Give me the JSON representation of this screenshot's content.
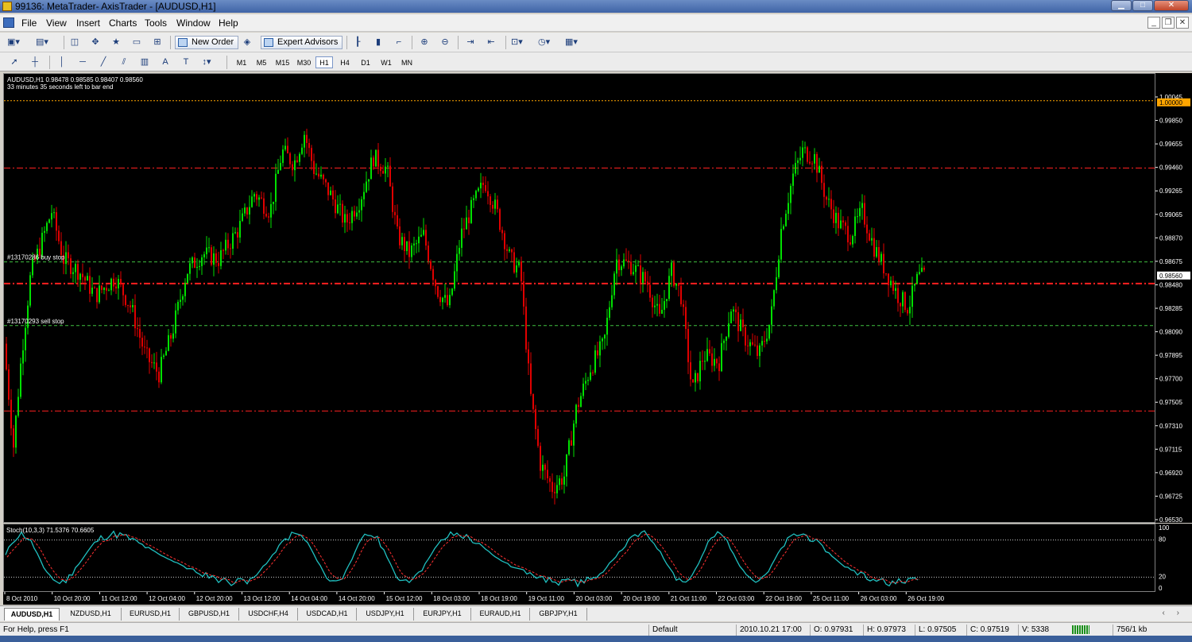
{
  "window": {
    "title": "99136: MetaTrader- AxisTrader - [AUDUSD,H1]"
  },
  "menu": [
    "File",
    "View",
    "Insert",
    "Charts",
    "Tools",
    "Window",
    "Help"
  ],
  "toolbar": {
    "new_order": "New Order",
    "expert_advisors": "Expert Advisors",
    "text_tool": "A",
    "text_label_tool": "T",
    "timeframes": [
      "M1",
      "M5",
      "M15",
      "M30",
      "H1",
      "H4",
      "D1",
      "W1",
      "MN"
    ],
    "active_timeframe": "H1"
  },
  "chart": {
    "header": "AUDUSD,H1  0.98478 0.98585 0.98407 0.98560",
    "countdown": "33 minutes 35 seconds left to bar end",
    "buy_stop_label": "#13170286 buy stop",
    "sell_stop_label": "#13170293 sell stop",
    "price_ticks": [
      "1.00045",
      "0.99850",
      "0.99655",
      "0.99460",
      "0.99265",
      "0.99065",
      "0.98870",
      "0.98675",
      "0.98480",
      "0.98285",
      "0.98090",
      "0.97895",
      "0.97700",
      "0.97505",
      "0.97310",
      "0.97115",
      "0.96920",
      "0.96725",
      "0.96530"
    ],
    "current_price": "0.98560",
    "marked_price": "1.00000",
    "colors": {
      "bull": "#00e000",
      "bear": "#e00000",
      "level": "#ff2020",
      "stop": "#40c040",
      "top": "#ffa500",
      "stoch_main": "#20c0c0",
      "stoch_signal": "#ff3030"
    }
  },
  "stoch": {
    "label": "Stoch(10,3,3) 71.5376 70.6605",
    "ticks": [
      "100",
      "80",
      "20",
      "0"
    ]
  },
  "time_labels": [
    "8 Oct 2010",
    "10 Oct 20:00",
    "11 Oct 12:00",
    "12 Oct 04:00",
    "12 Oct 20:00",
    "13 Oct 12:00",
    "14 Oct 04:00",
    "14 Oct 20:00",
    "15 Oct 12:00",
    "18 Oct 03:00",
    "18 Oct 19:00",
    "19 Oct 11:00",
    "20 Oct 03:00",
    "20 Oct 19:00",
    "21 Oct 11:00",
    "22 Oct 03:00",
    "22 Oct 19:00",
    "25 Oct 11:00",
    "26 Oct 03:00",
    "26 Oct 19:00"
  ],
  "tabs": [
    "AUDUSD,H1",
    "NZDUSD,H1",
    "EURUSD,H1",
    "GBPUSD,H1",
    "USDCHF,H4",
    "USDCAD,H1",
    "USDJPY,H1",
    "EURJPY,H1",
    "EURAUD,H1",
    "GBPJPY,H1"
  ],
  "status": {
    "help": "For Help, press F1",
    "profile": "Default",
    "datetime": "2010.10.21 17:00",
    "open": "O: 0.97931",
    "high": "H: 0.97973",
    "low": "L: 0.97505",
    "close": "C: 0.97519",
    "volume": "V: 5338",
    "traffic": "756/1 kb"
  }
}
